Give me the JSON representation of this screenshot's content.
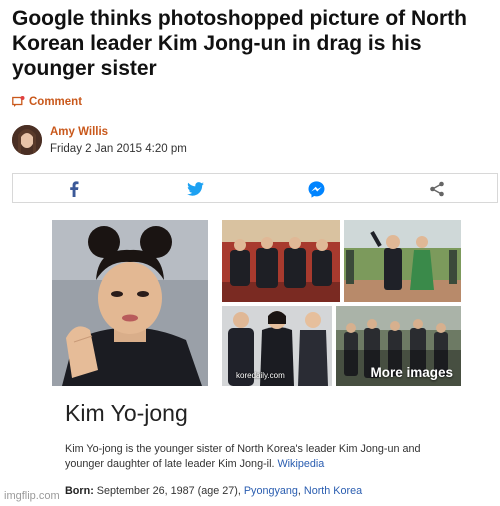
{
  "article": {
    "headline": "Google thinks photoshopped picture of North Korean leader Kim Jong-un in drag is his younger sister",
    "comment_label": "Comment",
    "author": "Amy Willis",
    "date": "Friday 2 Jan 2015 4:20 pm"
  },
  "share": {
    "icons": [
      "facebook-icon",
      "twitter-icon",
      "messenger-icon",
      "share-icon"
    ],
    "colors": {
      "facebook": "#3b5998",
      "twitter": "#1da1f2",
      "messenger": "#0084ff",
      "share": "#666666"
    }
  },
  "knowledge_panel": {
    "thumb_watermark": "koredaily.com",
    "more_images": "More images",
    "title": "Kim Yo-jong",
    "desc_text": "Kim Yo-jong is the younger sister of North Korea's leader Kim Jong-un and younger daughter of late leader Kim Jong-il.",
    "desc_link": "Wikipedia",
    "born_label": "Born:",
    "born_text": "September 26, 1987 (age 27),",
    "born_place_1": "Pyongyang",
    "born_sep": ",",
    "born_place_2": "North Korea"
  },
  "watermark": "imgflip.com",
  "colors": {
    "accent": "#c9581b",
    "link": "#2a5db0"
  }
}
